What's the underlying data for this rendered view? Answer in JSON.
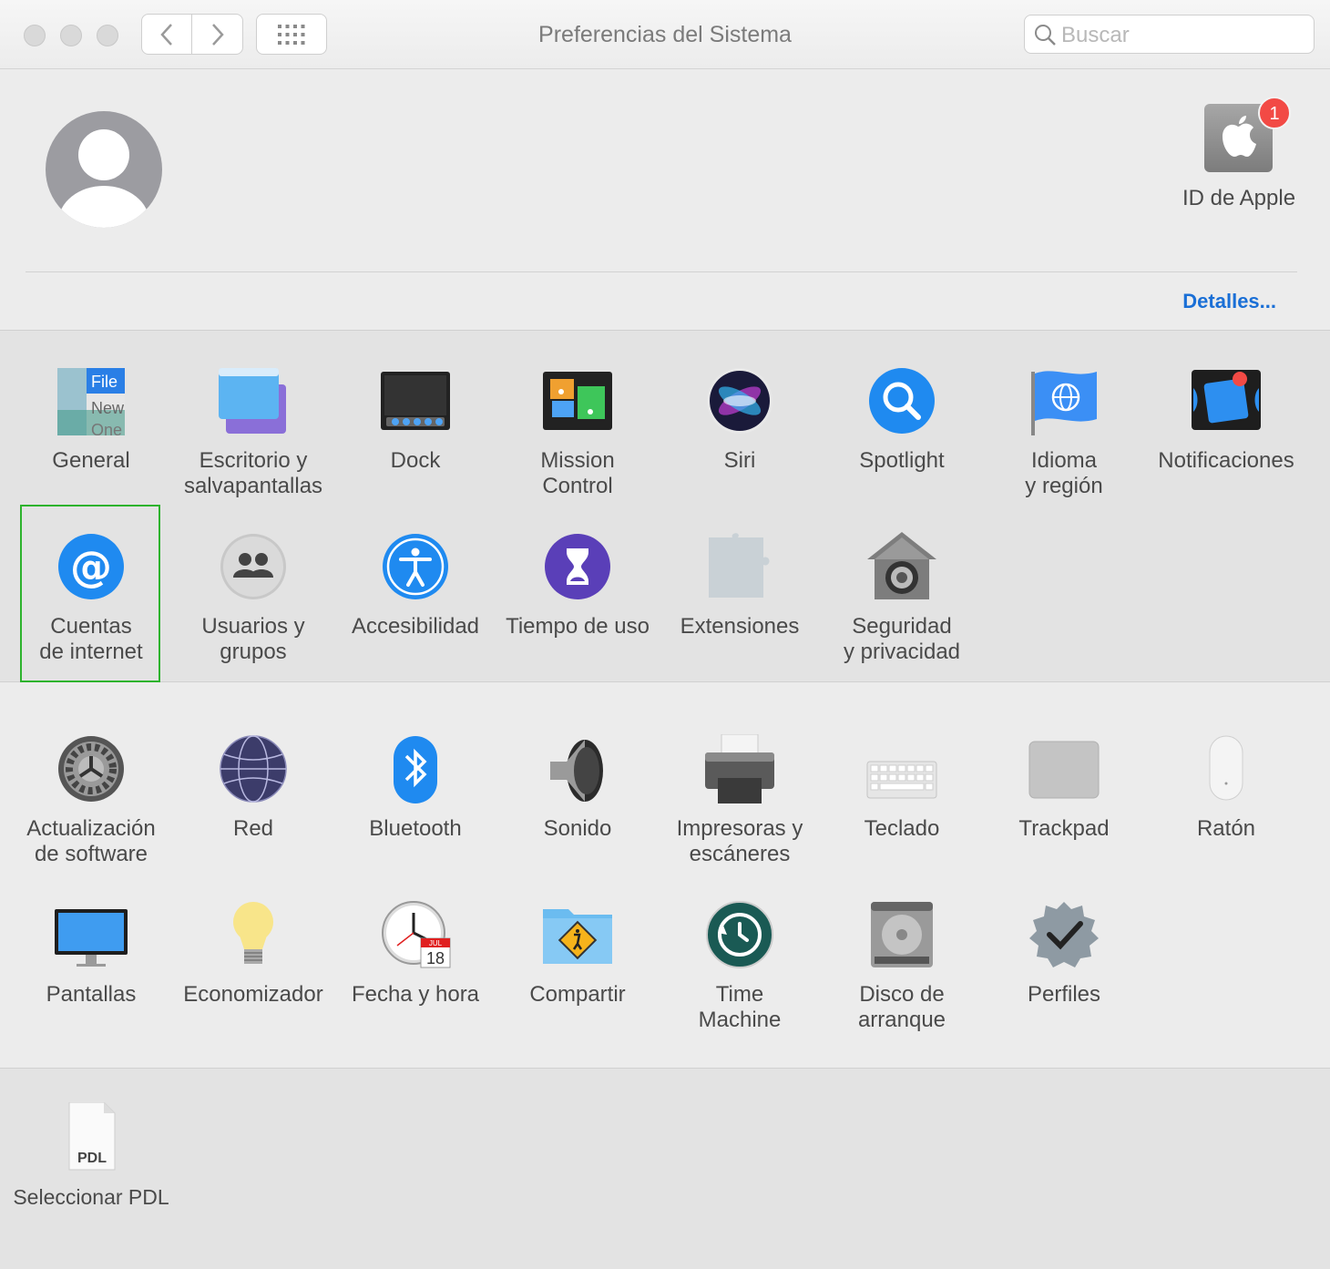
{
  "window": {
    "title": "Preferencias del Sistema"
  },
  "search": {
    "placeholder": "Buscar",
    "value": ""
  },
  "account": {
    "apple_id_label": "ID de Apple",
    "apple_id_badge": "1",
    "details_link": "Detalles..."
  },
  "panes_row1": [
    {
      "label": "General",
      "icon": "general-icon"
    },
    {
      "label": "Escritorio y\nsalvapantallas",
      "icon": "desktop-screensaver-icon"
    },
    {
      "label": "Dock",
      "icon": "dock-icon"
    },
    {
      "label": "Mission\nControl",
      "icon": "mission-control-icon"
    },
    {
      "label": "Siri",
      "icon": "siri-icon"
    },
    {
      "label": "Spotlight",
      "icon": "spotlight-icon"
    },
    {
      "label": "Idioma\ny región",
      "icon": "language-region-icon"
    },
    {
      "label": "Notificaciones",
      "icon": "notifications-icon"
    }
  ],
  "panes_row2": [
    {
      "label": "Cuentas\nde internet",
      "icon": "internet-accounts-icon",
      "selected": true
    },
    {
      "label": "Usuarios y\ngrupos",
      "icon": "users-groups-icon"
    },
    {
      "label": "Accesibilidad",
      "icon": "accessibility-icon"
    },
    {
      "label": "Tiempo de uso",
      "icon": "screen-time-icon"
    },
    {
      "label": "Extensiones",
      "icon": "extensions-icon"
    },
    {
      "label": "Seguridad\ny privacidad",
      "icon": "security-privacy-icon"
    }
  ],
  "panes_row3": [
    {
      "label": "Actualización\nde software",
      "icon": "software-update-icon"
    },
    {
      "label": "Red",
      "icon": "network-icon"
    },
    {
      "label": "Bluetooth",
      "icon": "bluetooth-icon"
    },
    {
      "label": "Sonido",
      "icon": "sound-icon"
    },
    {
      "label": "Impresoras y\nescáneres",
      "icon": "printers-scanners-icon"
    },
    {
      "label": "Teclado",
      "icon": "keyboard-icon"
    },
    {
      "label": "Trackpad",
      "icon": "trackpad-icon"
    },
    {
      "label": "Ratón",
      "icon": "mouse-icon"
    }
  ],
  "panes_row4": [
    {
      "label": "Pantallas",
      "icon": "displays-icon"
    },
    {
      "label": "Economizador",
      "icon": "energy-saver-icon"
    },
    {
      "label": "Fecha y hora",
      "icon": "date-time-icon"
    },
    {
      "label": "Compartir",
      "icon": "sharing-icon"
    },
    {
      "label": "Time\nMachine",
      "icon": "time-machine-icon"
    },
    {
      "label": "Disco de\narranque",
      "icon": "startup-disk-icon"
    },
    {
      "label": "Perfiles",
      "icon": "profiles-icon"
    }
  ],
  "panes_other": [
    {
      "label": "Seleccionar PDL",
      "icon": "pdl-file-icon"
    }
  ],
  "icon_text": {
    "general_lines": [
      "File",
      "New",
      "One"
    ],
    "calendar_month": "JUL",
    "calendar_day": "18",
    "pdl_label": "PDL"
  },
  "colors": {
    "accent_link": "#1a6fd6",
    "selection_border": "#2db32d",
    "badge": "#f24a45"
  }
}
